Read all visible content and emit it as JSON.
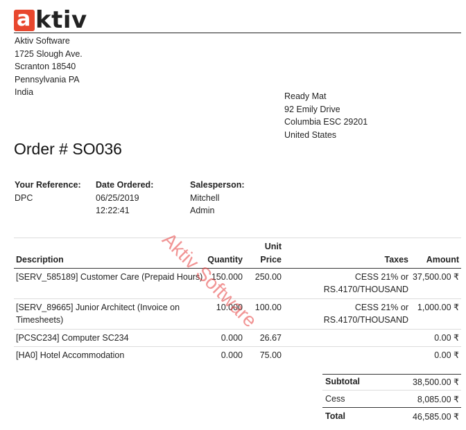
{
  "logo": {
    "mark_letter": "a",
    "text": "ktiv"
  },
  "company": {
    "lines": [
      "Aktiv Software",
      "1725 Slough Ave.",
      "Scranton 18540",
      "Pennsylvania PA",
      "India"
    ]
  },
  "customer": {
    "lines": [
      "Ready Mat",
      "92 Emily Drive",
      "Columbia ESC 29201",
      "United States"
    ]
  },
  "order_title": "Order # SO036",
  "info": {
    "reference_label": "Your Reference:",
    "reference_value": "DPC",
    "date_label": "Date Ordered:",
    "date_value_1": "06/25/2019",
    "date_value_2": "12:22:41",
    "salesperson_label": "Salesperson:",
    "salesperson_value_1": "Mitchell",
    "salesperson_value_2": "Admin"
  },
  "watermark": "Aktiv Software",
  "table": {
    "headers": {
      "description": "Description",
      "quantity": "Quantity",
      "unit_price_1": "Unit",
      "unit_price_2": "Price",
      "taxes": "Taxes",
      "amount": "Amount"
    },
    "rows": [
      {
        "desc_1": "[SERV_585189] Customer Care (Prepaid Hours)",
        "desc_2": "",
        "qty": "150.000",
        "price": "250.00",
        "tax_1": "CESS 21% or",
        "tax_2": "RS.4170/THOUSAND",
        "amount": "37,500.00 ₹"
      },
      {
        "desc_1": "[SERV_89665] Junior Architect (Invoice on",
        "desc_2": "Timesheets)",
        "qty": "10.000",
        "price": "100.00",
        "tax_1": "CESS 21% or",
        "tax_2": "RS.4170/THOUSAND",
        "amount": "1,000.00 ₹"
      },
      {
        "desc_1": "[PCSC234] Computer SC234",
        "desc_2": "",
        "qty": "0.000",
        "price": "26.67",
        "tax_1": "",
        "tax_2": "",
        "amount": "0.00 ₹"
      },
      {
        "desc_1": "[HA0] Hotel Accommodation",
        "desc_2": "",
        "qty": "0.000",
        "price": "75.00",
        "tax_1": "",
        "tax_2": "",
        "amount": "0.00 ₹"
      }
    ]
  },
  "totals": {
    "subtotal_label": "Subtotal",
    "subtotal_value": "38,500.00 ₹",
    "cess_label": "Cess",
    "cess_value": "8,085.00 ₹",
    "total_label": "Total",
    "total_value": "46,585.00 ₹"
  },
  "colors": {
    "logo_accent": "#e8472e",
    "watermark": "#e63c3c"
  }
}
